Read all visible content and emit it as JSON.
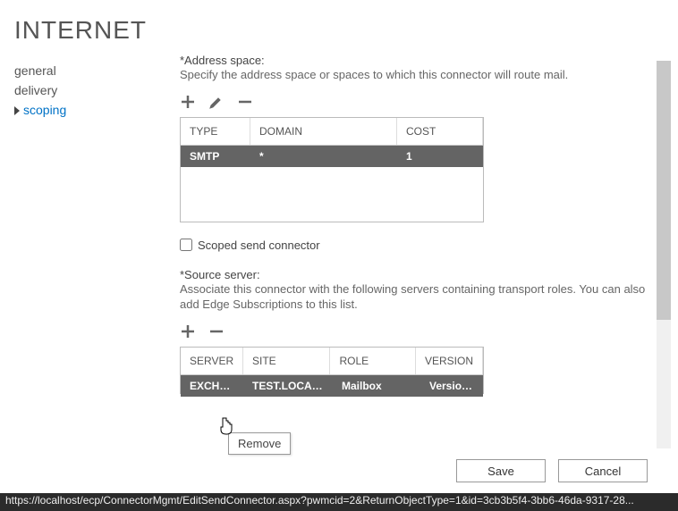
{
  "title": "INTERNET",
  "nav": {
    "items": [
      "general",
      "delivery",
      "scoping"
    ],
    "activeIndex": 2
  },
  "address": {
    "label": "*Address space:",
    "help": "Specify the address space or spaces to which this connector will route mail.",
    "headers": {
      "type": "TYPE",
      "domain": "DOMAIN",
      "cost": "COST"
    },
    "rows": [
      {
        "type": "SMTP",
        "domain": "*",
        "cost": "1"
      }
    ]
  },
  "scoped": {
    "label": "Scoped send connector",
    "checked": false
  },
  "source": {
    "label": "*Source server:",
    "help": "Associate this connector with the following servers containing transport roles. You can also add Edge Subscriptions to this list.",
    "headers": {
      "server": "SERVER",
      "site": "SITE",
      "role": "ROLE",
      "version": "VERSION"
    },
    "rows": [
      {
        "server": "EXCHA...",
        "site": "TEST.LOCAL/C...",
        "role": "Mailbox",
        "version": "Version ..."
      }
    ]
  },
  "tooltip": "Remove",
  "buttons": {
    "save": "Save",
    "cancel": "Cancel"
  },
  "statusUrl": "https://localhost/ecp/ConnectorMgmt/EditSendConnector.aspx?pwmcid=2&ReturnObjectType=1&id=3cb3b5f4-3bb6-46da-9317-28..."
}
